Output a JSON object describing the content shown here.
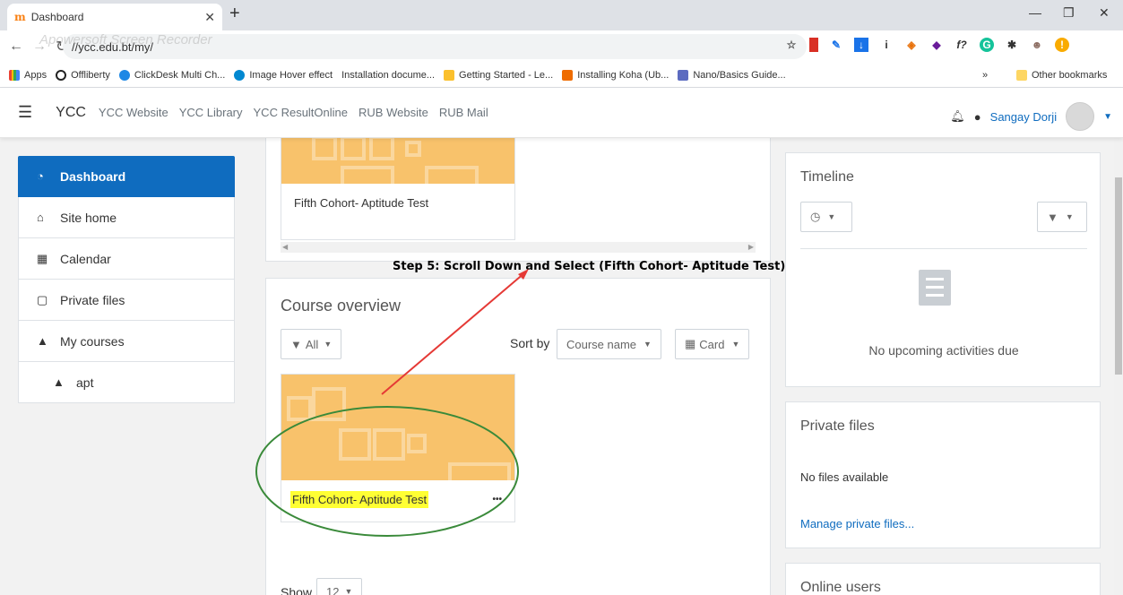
{
  "browser": {
    "tab_title": "Dashboard",
    "url": "//ycc.edu.bt/my/",
    "bookmarks": [
      "Apps",
      "Offliberty",
      "ClickDesk Multi Ch...",
      "Image Hover effect",
      "Installation docume...",
      "Getting Started - Le...",
      "Installing Koha (Ub...",
      "Nano/Basics Guide...",
      "»",
      "Other bookmarks"
    ],
    "watermark": "Apowersoft Screen Recorder"
  },
  "navbar": {
    "brand": "YCC",
    "links": [
      "YCC Website",
      "YCC Library",
      "YCC ResultOnline",
      "RUB Website",
      "RUB Mail"
    ],
    "username": "Sangay Dorji"
  },
  "drawer": {
    "items": [
      {
        "label": "Dashboard",
        "icon": "dashboard-icon"
      },
      {
        "label": "Site home",
        "icon": "home-icon"
      },
      {
        "label": "Calendar",
        "icon": "calendar-icon"
      },
      {
        "label": "Private files",
        "icon": "file-icon"
      },
      {
        "label": "My courses",
        "icon": "graduation-cap-icon"
      },
      {
        "label": "apt",
        "icon": "graduation-cap-icon"
      }
    ]
  },
  "recent": {
    "course_name": "Fifth Cohort- Aptitude Test"
  },
  "annotation": {
    "text": "Step 5: Scroll Down and Select (Fifth Cohort- Aptitude Test)",
    "arrow_color": "#e53935",
    "ellipse_color": "#3a8a3a",
    "highlight_color": "#ffff33"
  },
  "overview": {
    "title": "Course overview",
    "filter_label": "All",
    "sort_by_label": "Sort by",
    "sort_value": "Course name",
    "view_value": "Card",
    "course_name": "Fifth Cohort- Aptitude Test",
    "more": "•••",
    "show_label": "Show",
    "show_value": "12"
  },
  "timeline": {
    "title": "Timeline",
    "empty": "No upcoming activities due"
  },
  "private_files": {
    "title": "Private files",
    "empty": "No files available",
    "manage_link": "Manage private files..."
  },
  "online_users": {
    "title": "Online users"
  },
  "colors": {
    "accent": "#0f6cbf",
    "course_image": "#f8c26b"
  }
}
